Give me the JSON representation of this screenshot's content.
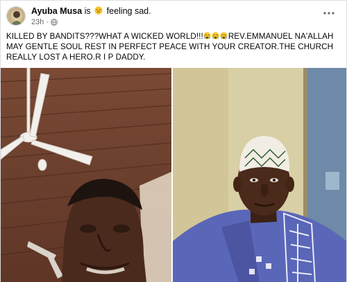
{
  "post": {
    "author": "Ayuba Musa",
    "connector": "is",
    "feeling_text": "feeling sad.",
    "feeling_icon": "sad-face-icon",
    "timestamp": "23h",
    "privacy_icon": "globe-icon",
    "menu_icon": "more-options-icon",
    "caption_part1": "KILLED BY BANDITS???WHAT A WICKED WORLD!!!",
    "caption_emoji": "crying-face-icon",
    "caption_emoji_count": 3,
    "caption_part2": "REV.EMMANUEL NA'ALLAH MAY GENTLE SOUL REST IN PERFECT PEACE WITH YOUR CREATOR.THE CHURCH REALLY LOST A HERO.R I P DADDY.",
    "photos": [
      {
        "description_icon": "photo-man-under-ceiling-fan"
      },
      {
        "description_icon": "photo-man-in-cap-blue-kaftan"
      }
    ]
  },
  "colors": {
    "text_primary": "#050505",
    "text_secondary": "#65676b",
    "emoji_yellow": "#f7c630",
    "kaftan_blue": "#5a66b8"
  }
}
